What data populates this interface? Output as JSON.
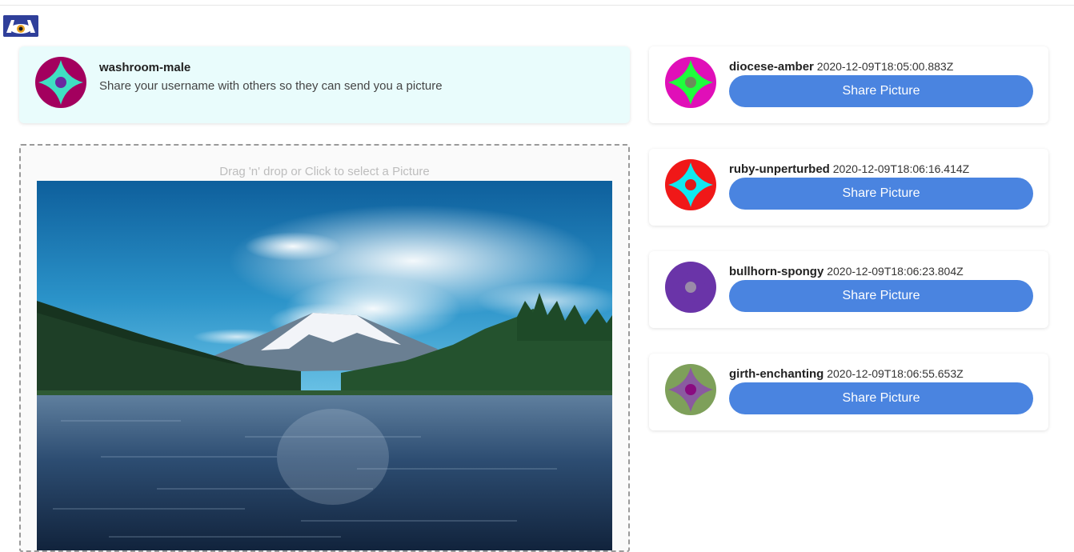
{
  "app": {
    "logo_icon": "eye-camera-logo-icon",
    "accent_color": "#4a84e0"
  },
  "me": {
    "username": "washroom-male",
    "hint": "Share your username with others so they can send you a picture",
    "avatar": {
      "icon": "geometric-avatar-icon",
      "bg": "#a3005e",
      "star": "#3fe0c2",
      "center": "#6a2aa0"
    },
    "card_bg": "#e9fcfc"
  },
  "dropzone": {
    "label": "Drag 'n' drop or Click to select a Picture",
    "picture": "mountain-lake-landscape"
  },
  "users": [
    {
      "username": "diocese-amber",
      "timestamp": "2020-12-09T18:05:00.883Z",
      "button": "Share Picture",
      "avatar": {
        "icon": "geometric-avatar-icon",
        "bg": "#e00fb8",
        "star": "#1eff3c",
        "center": "#6b8c5a"
      }
    },
    {
      "username": "ruby-unperturbed",
      "timestamp": "2020-12-09T18:06:16.414Z",
      "button": "Share Picture",
      "avatar": {
        "icon": "geometric-avatar-icon",
        "bg": "#f01818",
        "star": "#10e8f0",
        "center": "#e01818"
      }
    },
    {
      "username": "bullhorn-spongy",
      "timestamp": "2020-12-09T18:06:23.804Z",
      "button": "Share Picture",
      "avatar": {
        "icon": "geometric-avatar-icon",
        "bg": "#6a34a8",
        "star": "#6a34a8",
        "center": "#9a8aa8"
      }
    },
    {
      "username": "girth-enchanting",
      "timestamp": "2020-12-09T18:06:55.653Z",
      "button": "Share Picture",
      "avatar": {
        "icon": "geometric-avatar-icon",
        "bg": "#7ea05a",
        "star": "#8a5aa0",
        "center": "#8a0a80"
      }
    }
  ]
}
